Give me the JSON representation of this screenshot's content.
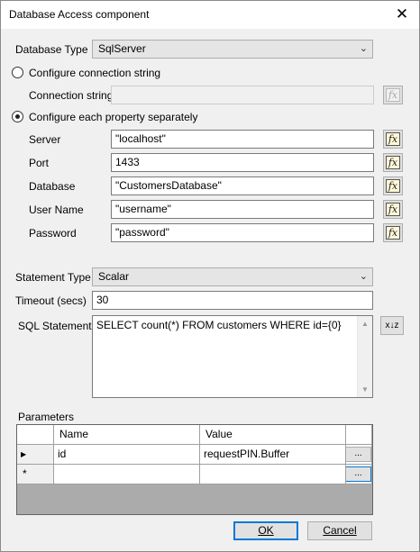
{
  "window": {
    "title": "Database Access component",
    "close_glyph": "✕"
  },
  "database_type": {
    "label": "Database Type",
    "value": "SqlServer"
  },
  "connection_mode": {
    "option_string_label": "Configure connection string",
    "option_properties_label": "Configure each property separately",
    "selected": "properties"
  },
  "connection_string": {
    "label": "Connection string",
    "value": ""
  },
  "properties": [
    {
      "label": "Server",
      "value": "\"localhost\""
    },
    {
      "label": "Port",
      "value": "1433"
    },
    {
      "label": "Database",
      "value": "\"CustomersDatabase\""
    },
    {
      "label": "User Name",
      "value": "\"username\""
    },
    {
      "label": "Password",
      "value": "\"password\""
    }
  ],
  "statement_type": {
    "label": "Statement Type",
    "value": "Scalar"
  },
  "timeout": {
    "label": "Timeout (secs)",
    "value": "30"
  },
  "sql_statement": {
    "label": "SQL Statement",
    "value": "SELECT count(*) FROM customers WHERE id={0}"
  },
  "parameters": {
    "label": "Parameters",
    "columns": [
      "Name",
      "Value"
    ],
    "rows": [
      {
        "indicator": "▶",
        "name": "id",
        "value": "requestPIN.Buffer"
      },
      {
        "indicator": "*",
        "name": "",
        "value": ""
      }
    ],
    "ellipsis_label": "..."
  },
  "buttons": {
    "ok_label": "OK",
    "cancel_label": "Cancel"
  },
  "icons": {
    "fx": "fx",
    "sort": "x↓z",
    "dropdown": "⌄"
  }
}
